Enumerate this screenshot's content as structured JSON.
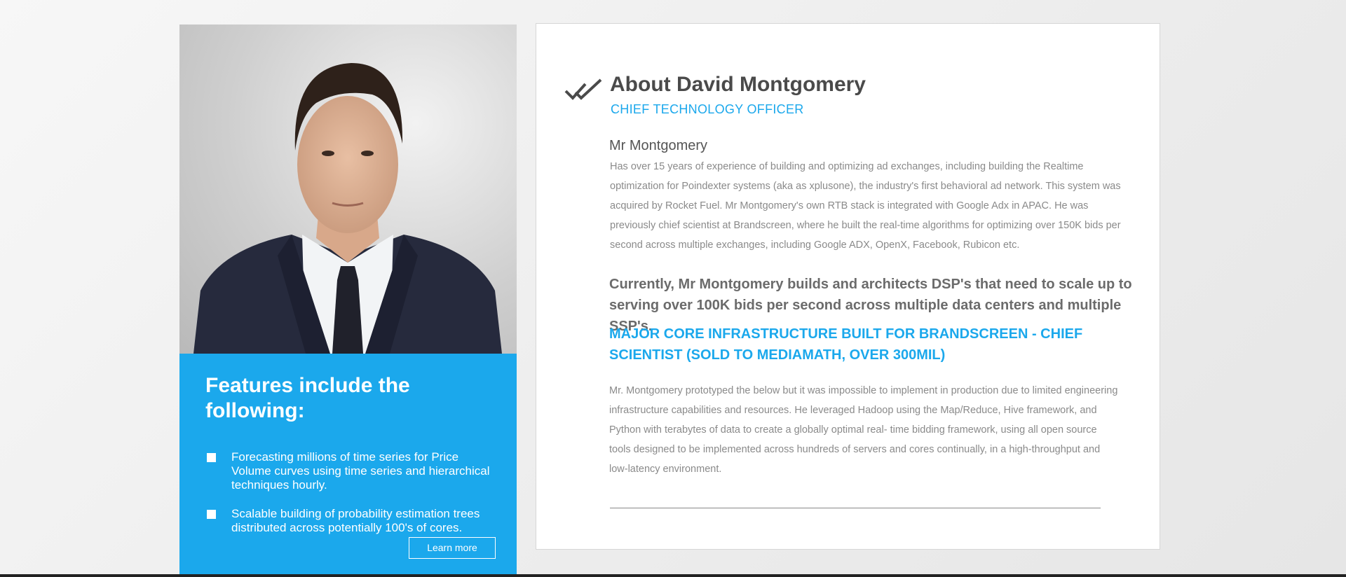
{
  "features": {
    "heading": "Features include the following:",
    "items": [
      "Forecasting millions of time series for Price Volume curves using time series and hierarchical techniques hourly.",
      "Scalable building of probability estimation trees distributed across potentially 100's of cores."
    ],
    "learn_more_label": "Learn more"
  },
  "about": {
    "title": "About David Montgomery",
    "role": "CHIEF TECHNOLOGY OFFICER",
    "name": "Mr Montgomery",
    "bio": "Has over 15 years of experience of building and optimizing ad exchanges, including building the Realtime optimization for Poindexter systems (aka as xplusone), the industry's first behavioral ad network. This system was acquired by Rocket Fuel. Mr Montgomery's own RTB stack is integrated with Google Adx in APAC. He was previously chief scientist at Brandscreen, where he built the real-time algorithms for optimizing over 150K bids per second across multiple exchanges, including Google ADX, OpenX, Facebook, Rubicon etc.",
    "current": "Currently, Mr Montgomery builds and architects DSP's that need to scale up to serving over 100K bids per second across multiple data centers and multiple SSP's.",
    "major": "MAJOR CORE INFRASTRUCTURE BUILT FOR BRANDSCREEN - CHIEF SCIENTIST (SOLD TO MEDIAMATH, OVER 300MIL)",
    "prototype": "Mr. Montgomery prototyped the below but it was impossible to implement in production due to limited engineering infrastructure capabilities and resources. He leveraged Hadoop using the Map/Reduce, Hive framework, and Python with terabytes of data to create a globally optimal real- time bidding framework, using all open source tools designed to be implemented across hundreds of servers and cores continually, in a high-throughput and low-latency environment."
  },
  "icons": {
    "check": "double-check-icon",
    "bullet": "square-bullet-icon"
  },
  "colors": {
    "accent": "#1ba8ec",
    "heading": "#4a4a4a",
    "body_text": "#8a8a8a"
  }
}
